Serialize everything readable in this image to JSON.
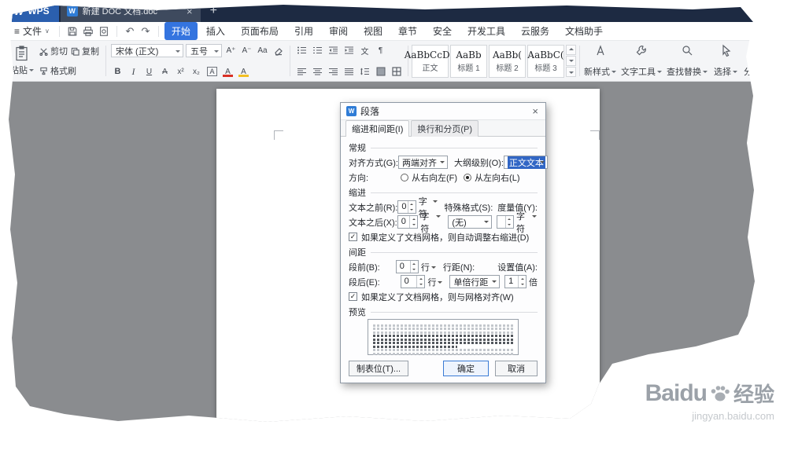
{
  "titlebar": {
    "brand": "WPS",
    "doc_tab": "新建 DOC 文档.doc"
  },
  "menubar": {
    "file_label": "文件",
    "tabs": [
      "开始",
      "插入",
      "页面布局",
      "引用",
      "审阅",
      "视图",
      "章节",
      "安全",
      "开发工具",
      "云服务",
      "文档助手"
    ]
  },
  "ribbon": {
    "paste": "粘贴",
    "cut": "剪切",
    "copy": "复制",
    "format_painter": "格式刷",
    "font_name": "宋体 (正文)",
    "font_size": "五号",
    "styles": [
      {
        "sample": "AaBbCcDd",
        "label": "正文"
      },
      {
        "sample": "AaBb",
        "label": "标题 1"
      },
      {
        "sample": "AaBb(",
        "label": "标题 2"
      },
      {
        "sample": "AaBbC(",
        "label": "标题 3"
      }
    ],
    "new_style": "新样式",
    "text_tool": "文字工具",
    "find_replace": "查找替换",
    "select": "选择",
    "share_doc": "分享文档"
  },
  "dialog": {
    "title": "段落",
    "tab_indent": "缩进和间距(I)",
    "tab_wrap": "换行和分页(P)",
    "general": {
      "heading": "常规",
      "align_label": "对齐方式(G):",
      "align_value": "两端对齐",
      "outline_label": "大纲级别(O):",
      "outline_value": "正文文本",
      "direction_label": "方向:",
      "rtl_label": "从右向左(F)",
      "ltr_label": "从左向右(L)"
    },
    "indent": {
      "heading": "缩进",
      "before_label": "文本之前(R):",
      "before_value": "0",
      "after_label": "文本之后(X):",
      "after_value": "0",
      "unit_char": "字符",
      "special_label": "特殊格式(S):",
      "special_value": "(无)",
      "measure_label": "度量值(Y):",
      "measure_value": "",
      "auto_adjust": "如果定义了文档网格，则自动调整右缩进(D)"
    },
    "spacing": {
      "heading": "间距",
      "before_label": "段前(B):",
      "before_value": "0",
      "after_label": "段后(E):",
      "after_value": "0",
      "unit_line": "行",
      "line_label": "行距(N):",
      "line_value": "单倍行距",
      "set_label": "设置值(A):",
      "set_value": "1",
      "set_unit": "倍",
      "grid_align": "如果定义了文档网格，则与网格对齐(W)"
    },
    "preview_heading": "预览",
    "tabs_button": "制表位(T)...",
    "ok": "确定",
    "cancel": "取消"
  },
  "watermark": {
    "brand_en": "Baidu",
    "brand_cn": "经验",
    "url": "jingyan.baidu.com"
  },
  "icons": {
    "w_logo": "W",
    "hamburger": "≡",
    "caret": "∨",
    "undo": "↶",
    "redo": "↷",
    "plus": "+",
    "close": "×",
    "check": "✓",
    "bold": "B",
    "italic": "I",
    "underline": "U",
    "strikethrough": "A",
    "superscript": "x²",
    "subscript": "x₂",
    "char_border": "A",
    "font_color": "A",
    "highlight": "A",
    "font_larger": "A⁺",
    "font_smaller": "A⁻",
    "change_case": "Aa",
    "asian_layout": "文",
    "para_mark": "¶"
  },
  "colors": {
    "accent_blue": "#3474df",
    "titlebar": "#1d2a42",
    "font_color_bar": "#d93025",
    "highlight_bar": "#f2bf24"
  }
}
